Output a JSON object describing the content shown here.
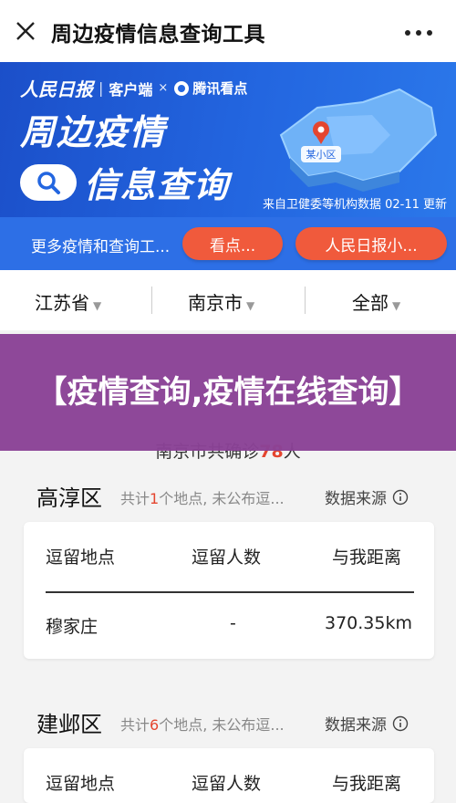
{
  "topbar": {
    "title": "周边疫情信息查询工具"
  },
  "banner": {
    "brand_logo": "人民日报",
    "brand_client": "客户端",
    "brand_x": "×",
    "brand_partner": "腾讯看点",
    "title_line1": "周边疫情",
    "title_line2": "信息查询",
    "map_label": "某小区",
    "source": "来自卫健委等机构数据 02-11 更新"
  },
  "morebar": {
    "text": "更多疫情和查询工...",
    "pill1": "看点...",
    "pill2": "人民日报小..."
  },
  "filters": {
    "province": "江苏省",
    "city": "南京市",
    "district": "全部"
  },
  "count_line": {
    "prefix": "南京市共确诊",
    "number": "78",
    "suffix": "人"
  },
  "overlay": {
    "text": "【疫情查询,疫情在线查询】"
  },
  "sections": [
    {
      "name": "高淳区",
      "summary_prefix": "共计",
      "summary_count": "1",
      "summary_suffix": "个地点, 未公布逗...",
      "source_label": "数据来源",
      "headers": [
        "逗留地点",
        "逗留人数",
        "与我距离"
      ],
      "row": {
        "place": "穆家庄",
        "people": "-",
        "distance": "370.35km"
      }
    },
    {
      "name": "建邺区",
      "summary_prefix": "共计",
      "summary_count": "6",
      "summary_suffix": "个地点, 未公布逗...",
      "source_label": "数据来源",
      "headers": [
        "逗留地点",
        "逗留人数",
        "与我距离"
      ]
    }
  ],
  "colors": {
    "banner_blue": "#2366e0",
    "pill_orange": "#f05a3c",
    "overlay_purple": "#8a4296",
    "highlight_red": "#e4452f"
  }
}
